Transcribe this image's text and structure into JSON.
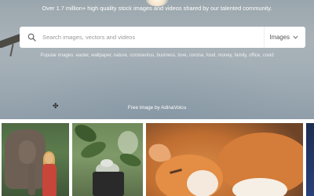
{
  "hero": {
    "tagline": "Over 1.7 million+ high quality stock images and videos shared by our talented community.",
    "search": {
      "placeholder": "Search images, vectors and videos",
      "type_label": "Images"
    },
    "popular": "Popular images: easter, wallpaper, nature, coronavirus, business, love, corona, food, money, family, office, covid",
    "credit": "Free image by AdinaVoicu"
  },
  "gallery": {
    "tiles": [
      {
        "subject": "elephant-and-girl"
      },
      {
        "subject": "succulent-in-pot"
      },
      {
        "subject": "sleeping-orange-cat"
      },
      {
        "subject": "partial-image"
      }
    ]
  },
  "icons": {
    "search": "search-icon",
    "dropdown": "chevron-down-icon"
  }
}
